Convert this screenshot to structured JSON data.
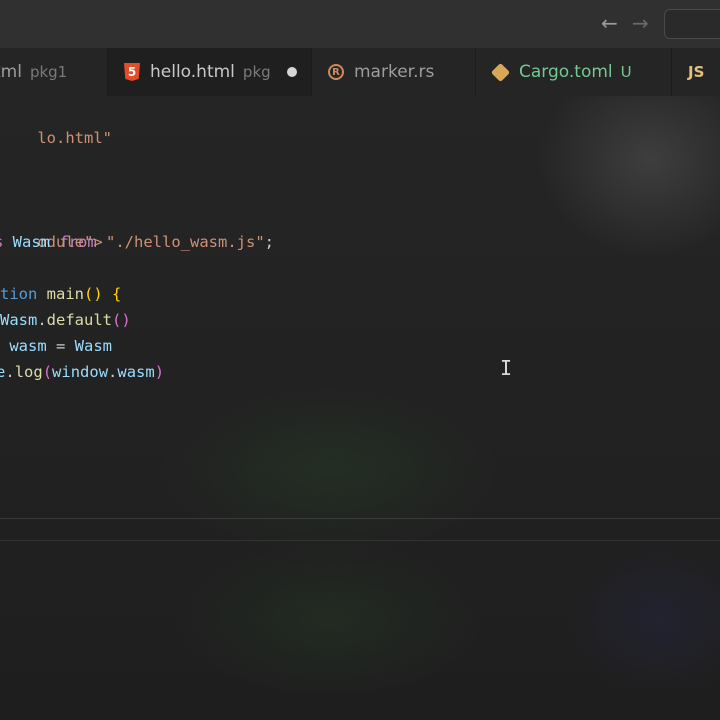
{
  "title_bar": {
    "back_glyph": "←",
    "forward_glyph": "→"
  },
  "tabs": [
    {
      "name": "tml",
      "description": "pkg1",
      "icon": "html-icon",
      "active": false
    },
    {
      "name": "hello.html",
      "description": "pkg",
      "icon": "html5-icon",
      "active": true,
      "dirty": true
    },
    {
      "name": "marker.rs",
      "icon": "rust-icon",
      "active": false
    },
    {
      "name": "Cargo.toml",
      "git_status": "U",
      "icon": "cargo-icon",
      "active": false
    },
    {
      "name": "",
      "icon_text": "JS",
      "icon": "js-icon",
      "active": false
    }
  ],
  "editor": {
    "lines": [
      {
        "parts": [
          "lo.html\""
        ]
      },
      {
        "parts": [
          "odule\">"
        ]
      },
      {
        "parts": [
          " Wasm",
          " from ",
          "\"./hello_wasm.js\"",
          ";"
        ]
      },
      {
        "parts": [
          "tion ",
          "main",
          "(",
          ")",
          " ",
          "{"
        ]
      },
      {
        "parts": [
          "Wasm",
          ".",
          "default",
          "()"
        ]
      },
      {
        "parts": [
          " wasm",
          " = ",
          "Wasm"
        ]
      },
      {
        "parts": [
          ".",
          "log",
          "(",
          "window",
          ".",
          "wasm",
          ")"
        ]
      }
    ]
  },
  "colors": {
    "background": "#1f1f1f",
    "titlebar": "#303030",
    "tabbar": "#252525",
    "string": "#ce9178",
    "keyword": "#c586c0",
    "function": "#dcdcaa",
    "variable": "#9cdcfe",
    "git_untracked": "#73c991"
  }
}
